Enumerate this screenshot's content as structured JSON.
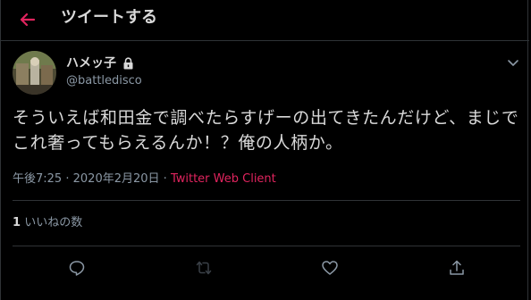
{
  "header": {
    "title": "ツイートする",
    "back_icon": "arrow-left-icon",
    "accent": "#e0245e"
  },
  "tweet": {
    "author": {
      "display_name": "ハメッ子",
      "handle": "@battledisco",
      "locked": true
    },
    "text": "そういえば和田金で調べたらすげーの出てきたんだけど、まじでこれ奢ってもらえるんか！？俺の人柄か。",
    "time": "午後7:25",
    "separator": "·",
    "date": "2020年2月20日",
    "source": "Twitter Web Client",
    "like_count": "1",
    "like_label": "いいねの数"
  },
  "actions": [
    "reply-icon",
    "retweet-icon",
    "like-icon",
    "share-icon"
  ]
}
